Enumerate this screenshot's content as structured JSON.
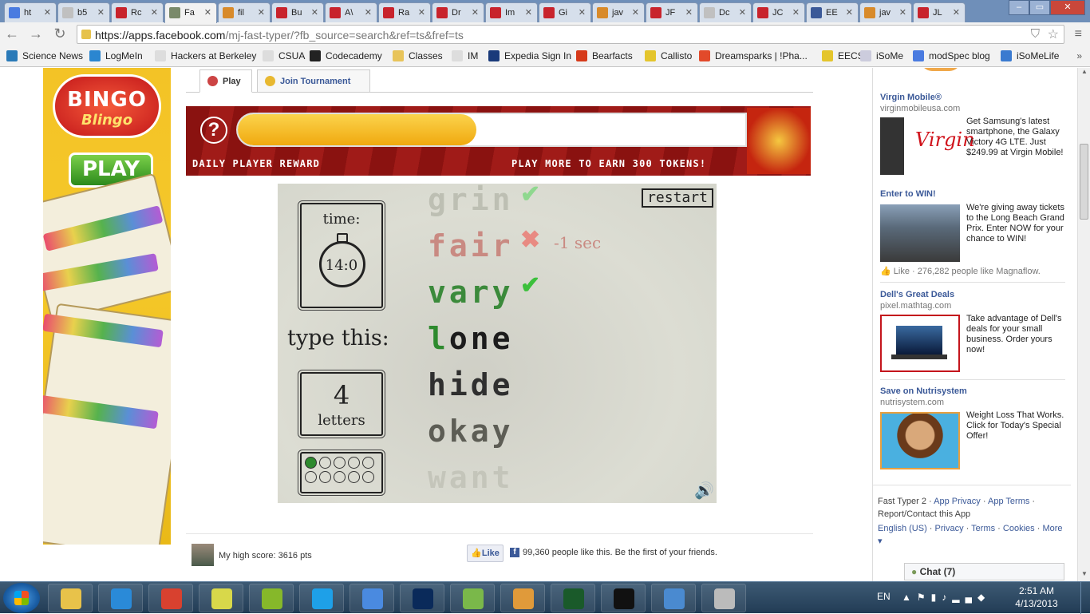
{
  "browser": {
    "tabs": [
      {
        "label": "ht",
        "color": "#4a7be0"
      },
      {
        "label": "b5",
        "color": "#c0c0c0"
      },
      {
        "label": "Rc",
        "color": "#c8232c"
      },
      {
        "label": "Fa",
        "color": "#7a8a6a",
        "active": true
      },
      {
        "label": "fil",
        "color": "#d88a2a"
      },
      {
        "label": "Bu",
        "color": "#c8232c"
      },
      {
        "label": "A\\",
        "color": "#c8232c"
      },
      {
        "label": "Ra",
        "color": "#c8232c"
      },
      {
        "label": "Dr",
        "color": "#c8232c"
      },
      {
        "label": "Im",
        "color": "#c8232c"
      },
      {
        "label": "Gi",
        "color": "#c8232c"
      },
      {
        "label": "jav",
        "color": "#d88a2a"
      },
      {
        "label": "JF",
        "color": "#c8232c"
      },
      {
        "label": "Dc",
        "color": "#c0c0c0"
      },
      {
        "label": "JC",
        "color": "#c8232c"
      },
      {
        "label": "EE",
        "color": "#3b5998"
      },
      {
        "label": "jav",
        "color": "#d88a2a"
      },
      {
        "label": "JL",
        "color": "#c8232c"
      }
    ],
    "url_host": "https://apps.facebook.com",
    "url_path": "/mj-fast-typer/?fb_source=search&ref=ts&fref=ts",
    "bookmarks": [
      {
        "label": "Science News",
        "color": "#2a7ab8"
      },
      {
        "label": "LogMeIn",
        "color": "#2b86d0"
      },
      {
        "label": "Hackers at Berkeley",
        "color": "#ddd"
      },
      {
        "label": "CSUA",
        "color": "#ddd"
      },
      {
        "label": "Codecademy",
        "color": "#222"
      },
      {
        "label": "Classes",
        "color": "#e8c45a"
      },
      {
        "label": "IM",
        "color": "#ddd"
      },
      {
        "label": "Expedia Sign In",
        "color": "#1a3a7a"
      },
      {
        "label": "Bearfacts",
        "color": "#d63a1a"
      },
      {
        "label": "Callisto",
        "color": "#e4c52c"
      },
      {
        "label": "Dreamsparks | !Pha...",
        "color": "#e24a2a"
      },
      {
        "label": "EECS",
        "color": "#e4c52c"
      },
      {
        "label": "iSoMe",
        "color": "#ccd"
      },
      {
        "label": "modSpec blog",
        "color": "#4a7be0"
      },
      {
        "label": "iSoMeLife",
        "color": "#3a7ad0"
      }
    ]
  },
  "app_tabs": {
    "play": "Play",
    "tournament": "Join Tournament"
  },
  "reward": {
    "left_text": "DAILY PLAYER REWARD",
    "right_text": "PLAY MORE TO EARN 300 TOKENS!",
    "progress": 0.47,
    "help": "?"
  },
  "game": {
    "restart": "restart",
    "time_label": "time:",
    "time_value": "14:0",
    "type_label": "type this:",
    "letters_count": "4",
    "letters_label": "letters",
    "penalty": "-1 sec",
    "words": [
      {
        "text": "grin",
        "state": "correct-faded",
        "color": "#bdbfb3"
      },
      {
        "text": "fair",
        "state": "wrong",
        "color": "#c98a82"
      },
      {
        "text": "vary",
        "state": "correct",
        "color": "#3b8a3b"
      },
      {
        "text": "lone",
        "state": "current",
        "color": "#1c1c1c"
      },
      {
        "text": "hide",
        "state": "upcoming",
        "color": "#2f2f2f"
      },
      {
        "text": "okay",
        "state": "upcoming",
        "color": "#5d5d55"
      },
      {
        "text": "want",
        "state": "upcoming",
        "color": "#c4c5ba"
      }
    ],
    "progress_dots_filled": 1,
    "progress_dots_total": 10
  },
  "bottom": {
    "high_score": "My high score: 3616 pts",
    "like_button": "Like",
    "likes_text": "99,360 people like this. Be the first of your friends."
  },
  "ads": [
    {
      "title": "Virgin Mobile®",
      "domain": "virginmobileusa.com",
      "body": "Get Samsung's latest smartphone, the Galaxy Victory 4G LTE. Just $249.99 at Virgin Mobile!"
    },
    {
      "title": "Enter to WIN!",
      "domain": "",
      "body": "We're giving away tickets to the Long Beach Grand Prix. Enter NOW for your chance to WIN!",
      "social": "Like · 276,282 people like Magnaflow."
    },
    {
      "title": "Dell's Great Deals",
      "domain": "pixel.mathtag.com",
      "body": "Take advantage of Dell's deals for your small business. Order yours now!"
    },
    {
      "title": "Save on Nutrisystem",
      "domain": "nutrisystem.com",
      "body": "Weight Loss That Works. Click for Today's Special Offer!"
    }
  ],
  "footer": {
    "app_name": "Fast Typer 2",
    "app_privacy": "App Privacy",
    "app_terms": "App Terms",
    "report": "Report/Contact this App",
    "language": "English (US)",
    "privacy": "Privacy",
    "terms": "Terms",
    "cookies": "Cookies",
    "more": "More"
  },
  "chat": {
    "label": "Chat (7)"
  },
  "taskbar": {
    "lang": "EN",
    "time": "2:51 AM",
    "date": "4/13/2013",
    "apps": [
      {
        "name": "explorer",
        "color": "#e8c24a"
      },
      {
        "name": "internet-explorer",
        "color": "#2a8ad8"
      },
      {
        "name": "chrome",
        "color": "#d8412f"
      },
      {
        "name": "sticky-notes",
        "color": "#d8d84a"
      },
      {
        "name": "spotify",
        "color": "#86b82a"
      },
      {
        "name": "skype",
        "color": "#1ea0e8"
      },
      {
        "name": "itunes",
        "color": "#4a8ae0"
      },
      {
        "name": "photoshop",
        "color": "#0a2a5a"
      },
      {
        "name": "notepad-plus",
        "color": "#7ab84a"
      },
      {
        "name": "paint",
        "color": "#e09a3a"
      },
      {
        "name": "task-manager",
        "color": "#1a5a2a"
      },
      {
        "name": "command-prompt",
        "color": "#111"
      },
      {
        "name": "control-panel",
        "color": "#4a8ad0"
      },
      {
        "name": "mouse",
        "color": "#bbb"
      }
    ]
  },
  "left_ad": {
    "logo_top": "BINGO",
    "logo_bottom": "Blingo",
    "play": "PLAY"
  }
}
